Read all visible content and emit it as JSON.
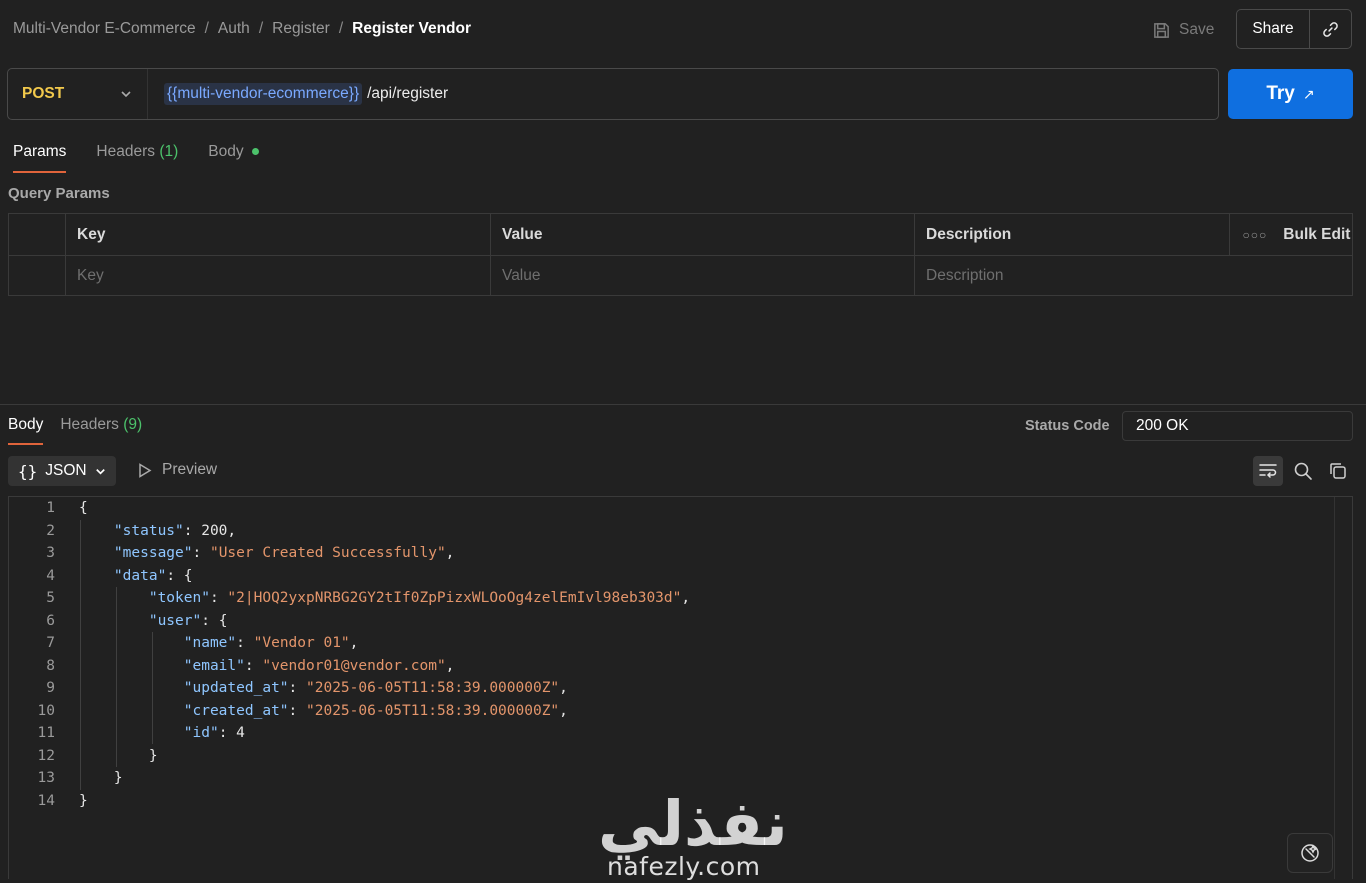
{
  "breadcrumb": {
    "items": [
      "Multi-Vendor E-Commerce",
      "Auth",
      "Register"
    ],
    "separator": "/",
    "current": "Register Vendor"
  },
  "header": {
    "save_label": "Save",
    "share_label": "Share",
    "link_icon": "link-icon",
    "save_icon": "floppy-disk-icon"
  },
  "request": {
    "method": "POST",
    "url_variable": "{{multi-vendor-ecommerce}}",
    "url_path": "/api/register",
    "try_label": "Try",
    "try_arrow": "↗"
  },
  "request_tabs": {
    "params": "Params",
    "headers": "Headers",
    "headers_count": "(1)",
    "body": "Body"
  },
  "query_params": {
    "title": "Query Params",
    "headers": {
      "key": "Key",
      "value": "Value",
      "description": "Description"
    },
    "bulk_edit": "Bulk Edit",
    "placeholders": {
      "key": "Key",
      "value": "Value",
      "description": "Description"
    }
  },
  "response_tabs": {
    "body": "Body",
    "headers": "Headers",
    "headers_count": "(9)"
  },
  "response": {
    "status_label": "Status Code",
    "status_value": "200 OK",
    "format": "JSON",
    "format_braces": "{}",
    "preview": "Preview"
  },
  "code_lines": [
    {
      "n": "1",
      "text": "{"
    },
    {
      "n": "2",
      "text": "    \"status\": 200,"
    },
    {
      "n": "3",
      "text": "    \"message\": \"User Created Successfully\","
    },
    {
      "n": "4",
      "text": "    \"data\": {"
    },
    {
      "n": "5",
      "text": "        \"token\": \"2|HOQ2yxpNRBG2GY2tIf0ZpPizxWLOoOg4zelEmIvl98eb303d\","
    },
    {
      "n": "6",
      "text": "        \"user\": {"
    },
    {
      "n": "7",
      "text": "            \"name\": \"Vendor 01\","
    },
    {
      "n": "8",
      "text": "            \"email\": \"vendor01@vendor.com\","
    },
    {
      "n": "9",
      "text": "            \"updated_at\": \"2025-06-05T11:58:39.000000Z\","
    },
    {
      "n": "10",
      "text": "            \"created_at\": \"2025-06-05T11:58:39.000000Z\","
    },
    {
      "n": "11",
      "text": "            \"id\": 4"
    },
    {
      "n": "12",
      "text": "        }"
    },
    {
      "n": "13",
      "text": "    }"
    },
    {
      "n": "14",
      "text": "}"
    }
  ],
  "watermark": {
    "arabic": "نفذلي",
    "domain": "nafezly.com"
  },
  "colors": {
    "accent": "#e0643b",
    "try_button": "#0f6fe0",
    "method": "#f2c94c",
    "json_key": "#8fc6ff",
    "json_string": "#e3956b",
    "count_green": "#4cc26b"
  }
}
